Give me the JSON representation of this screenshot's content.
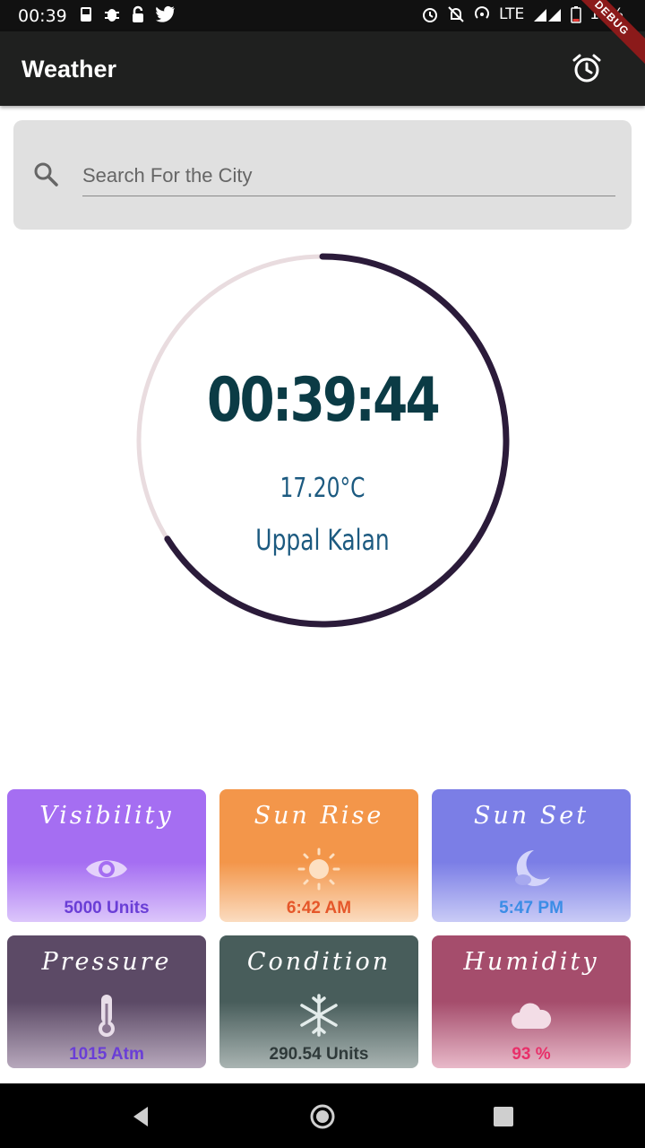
{
  "status_bar": {
    "time": "00:39",
    "network": "LTE",
    "battery": "12%",
    "left_icons": [
      "phone-icon",
      "bug-icon",
      "lock-icon",
      "twitter-icon"
    ],
    "right_icons": [
      "alarm-icon",
      "dnd-icon",
      "hotspot-icon",
      "signal-icon",
      "battery-icon"
    ]
  },
  "app_bar": {
    "title": "Weather",
    "debug_banner": "DEBUG",
    "action_icon": "alarm-clock-icon"
  },
  "search": {
    "placeholder": "Search For the City",
    "value": "",
    "icon": "search-icon"
  },
  "clock": {
    "time": "00:39:44",
    "temperature": "17.20°C",
    "city": "Uppal Kalan",
    "progress_fraction": 0.66,
    "track_color": "#e9dcdf",
    "progress_color": "#2b1b3a"
  },
  "tiles": [
    {
      "title": "Visibility",
      "icon": "eye-icon",
      "value": "5000 Units",
      "value_color": "#6a3ed6"
    },
    {
      "title": "Sun Rise",
      "icon": "sun-icon",
      "value": "6:42 AM",
      "value_color": "#e5572a"
    },
    {
      "title": "Sun Set",
      "icon": "moon-icon",
      "value": "5:47 PM",
      "value_color": "#3b8de6"
    },
    {
      "title": "Pressure",
      "icon": "thermometer-icon",
      "value": "1015 Atm",
      "value_color": "#6a3ed6"
    },
    {
      "title": "Condition",
      "icon": "snowflake-icon",
      "value": "290.54 Units",
      "value_color": "#2f3a3a"
    },
    {
      "title": "Humidity",
      "icon": "cloud-icon",
      "value": "93 %",
      "value_color": "#e8306a"
    }
  ],
  "nav_bar": {
    "buttons": [
      "back-icon",
      "home-icon",
      "recents-icon"
    ]
  }
}
